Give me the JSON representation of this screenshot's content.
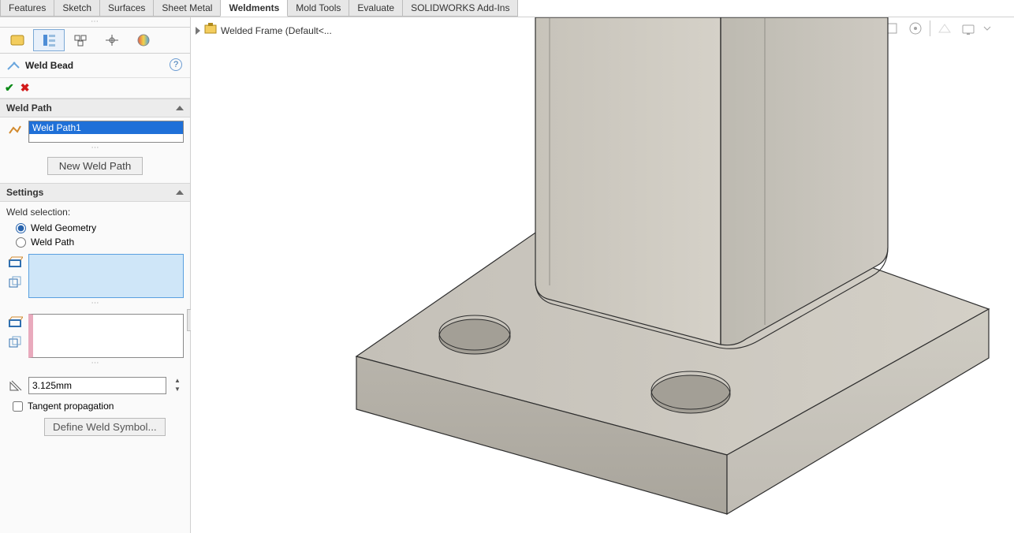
{
  "tabs": {
    "items": [
      {
        "label": "Features"
      },
      {
        "label": "Sketch"
      },
      {
        "label": "Surfaces"
      },
      {
        "label": "Sheet Metal"
      },
      {
        "label": "Weldments"
      },
      {
        "label": "Mold Tools"
      },
      {
        "label": "Evaluate"
      },
      {
        "label": "SOLIDWORKS Add-Ins"
      }
    ],
    "active": 4
  },
  "feature_manager": {
    "active_tab_index": 1
  },
  "property_manager": {
    "title": "Weld Bead",
    "weld_path": {
      "section_label": "Weld Path",
      "selected_item": "Weld Path1",
      "new_button_label": "New Weld Path"
    },
    "settings": {
      "section_label": "Settings",
      "weld_selection_label": "Weld selection:",
      "option_geometry": "Weld Geometry",
      "option_path": "Weld Path",
      "selected_option": "geometry",
      "size_value": "3.125mm",
      "tangent_label": "Tangent propagation",
      "tangent_checked": false,
      "define_symbol_label": "Define Weld Symbol..."
    }
  },
  "viewport": {
    "breadcrumb": "Welded Frame  (Default<..."
  }
}
